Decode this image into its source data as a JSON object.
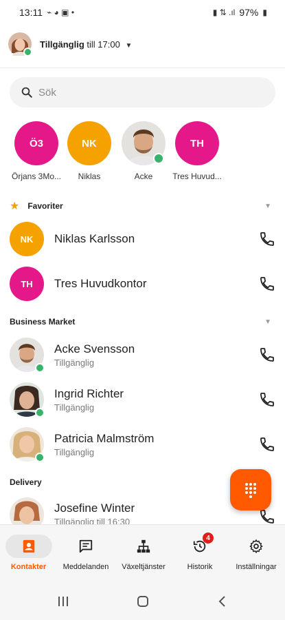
{
  "statusbar": {
    "time": "13:11",
    "left_icons": "⌁ ◕ ▣ •",
    "battery": "97%",
    "right_icons": "▮ ⇅ .ıl"
  },
  "presence": {
    "status": "Tillgänglig",
    "until": "till 17:00"
  },
  "search": {
    "placeholder": "Sök"
  },
  "quick_contacts": [
    {
      "initials": "Ö3",
      "label": "Örjans 3Mo...",
      "color": "#e5188a"
    },
    {
      "initials": "NK",
      "label": "Niklas",
      "color": "#f5a100"
    },
    {
      "initials": "",
      "label": "Acke",
      "photo": true
    },
    {
      "initials": "TH",
      "label": "Tres Huvud...",
      "color": "#e5188a"
    }
  ],
  "sections": {
    "favorites": "Favoriter",
    "business": "Business Market",
    "delivery": "Delivery"
  },
  "favorites": [
    {
      "initials": "NK",
      "name": "Niklas Karlsson",
      "color": "#f5a100"
    },
    {
      "initials": "TH",
      "name": "Tres Huvudkontor",
      "color": "#e5188a"
    }
  ],
  "business": [
    {
      "name": "Acke Svensson",
      "status": "Tillgänglig"
    },
    {
      "name": "Ingrid Richter",
      "status": "Tillgänglig"
    },
    {
      "name": "Patricia Malmström",
      "status": "Tillgänglig"
    }
  ],
  "delivery": [
    {
      "name": "Josefine Winter",
      "status": "Tillgänglig till 16:30"
    }
  ],
  "nav": {
    "contacts": "Kontakter",
    "messages": "Meddelanden",
    "switch": "Växeltjänster",
    "history": "Historik",
    "history_badge": "4",
    "settings": "Inställningar"
  },
  "colors": {
    "accent": "#ff5a00",
    "online": "#39b36b",
    "pink": "#e5188a",
    "amber": "#f5a100"
  }
}
